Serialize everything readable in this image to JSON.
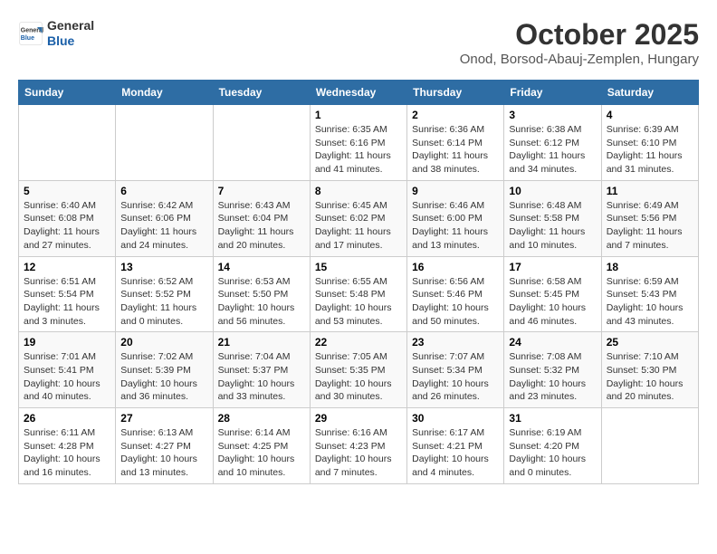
{
  "logo": {
    "line1": "General",
    "line2": "Blue"
  },
  "title": "October 2025",
  "location": "Onod, Borsod-Abauj-Zemplen, Hungary",
  "weekdays": [
    "Sunday",
    "Monday",
    "Tuesday",
    "Wednesday",
    "Thursday",
    "Friday",
    "Saturday"
  ],
  "weeks": [
    [
      {
        "day": "",
        "info": ""
      },
      {
        "day": "",
        "info": ""
      },
      {
        "day": "",
        "info": ""
      },
      {
        "day": "1",
        "info": "Sunrise: 6:35 AM\nSunset: 6:16 PM\nDaylight: 11 hours\nand 41 minutes."
      },
      {
        "day": "2",
        "info": "Sunrise: 6:36 AM\nSunset: 6:14 PM\nDaylight: 11 hours\nand 38 minutes."
      },
      {
        "day": "3",
        "info": "Sunrise: 6:38 AM\nSunset: 6:12 PM\nDaylight: 11 hours\nand 34 minutes."
      },
      {
        "day": "4",
        "info": "Sunrise: 6:39 AM\nSunset: 6:10 PM\nDaylight: 11 hours\nand 31 minutes."
      }
    ],
    [
      {
        "day": "5",
        "info": "Sunrise: 6:40 AM\nSunset: 6:08 PM\nDaylight: 11 hours\nand 27 minutes."
      },
      {
        "day": "6",
        "info": "Sunrise: 6:42 AM\nSunset: 6:06 PM\nDaylight: 11 hours\nand 24 minutes."
      },
      {
        "day": "7",
        "info": "Sunrise: 6:43 AM\nSunset: 6:04 PM\nDaylight: 11 hours\nand 20 minutes."
      },
      {
        "day": "8",
        "info": "Sunrise: 6:45 AM\nSunset: 6:02 PM\nDaylight: 11 hours\nand 17 minutes."
      },
      {
        "day": "9",
        "info": "Sunrise: 6:46 AM\nSunset: 6:00 PM\nDaylight: 11 hours\nand 13 minutes."
      },
      {
        "day": "10",
        "info": "Sunrise: 6:48 AM\nSunset: 5:58 PM\nDaylight: 11 hours\nand 10 minutes."
      },
      {
        "day": "11",
        "info": "Sunrise: 6:49 AM\nSunset: 5:56 PM\nDaylight: 11 hours\nand 7 minutes."
      }
    ],
    [
      {
        "day": "12",
        "info": "Sunrise: 6:51 AM\nSunset: 5:54 PM\nDaylight: 11 hours\nand 3 minutes."
      },
      {
        "day": "13",
        "info": "Sunrise: 6:52 AM\nSunset: 5:52 PM\nDaylight: 11 hours\nand 0 minutes."
      },
      {
        "day": "14",
        "info": "Sunrise: 6:53 AM\nSunset: 5:50 PM\nDaylight: 10 hours\nand 56 minutes."
      },
      {
        "day": "15",
        "info": "Sunrise: 6:55 AM\nSunset: 5:48 PM\nDaylight: 10 hours\nand 53 minutes."
      },
      {
        "day": "16",
        "info": "Sunrise: 6:56 AM\nSunset: 5:46 PM\nDaylight: 10 hours\nand 50 minutes."
      },
      {
        "day": "17",
        "info": "Sunrise: 6:58 AM\nSunset: 5:45 PM\nDaylight: 10 hours\nand 46 minutes."
      },
      {
        "day": "18",
        "info": "Sunrise: 6:59 AM\nSunset: 5:43 PM\nDaylight: 10 hours\nand 43 minutes."
      }
    ],
    [
      {
        "day": "19",
        "info": "Sunrise: 7:01 AM\nSunset: 5:41 PM\nDaylight: 10 hours\nand 40 minutes."
      },
      {
        "day": "20",
        "info": "Sunrise: 7:02 AM\nSunset: 5:39 PM\nDaylight: 10 hours\nand 36 minutes."
      },
      {
        "day": "21",
        "info": "Sunrise: 7:04 AM\nSunset: 5:37 PM\nDaylight: 10 hours\nand 33 minutes."
      },
      {
        "day": "22",
        "info": "Sunrise: 7:05 AM\nSunset: 5:35 PM\nDaylight: 10 hours\nand 30 minutes."
      },
      {
        "day": "23",
        "info": "Sunrise: 7:07 AM\nSunset: 5:34 PM\nDaylight: 10 hours\nand 26 minutes."
      },
      {
        "day": "24",
        "info": "Sunrise: 7:08 AM\nSunset: 5:32 PM\nDaylight: 10 hours\nand 23 minutes."
      },
      {
        "day": "25",
        "info": "Sunrise: 7:10 AM\nSunset: 5:30 PM\nDaylight: 10 hours\nand 20 minutes."
      }
    ],
    [
      {
        "day": "26",
        "info": "Sunrise: 6:11 AM\nSunset: 4:28 PM\nDaylight: 10 hours\nand 16 minutes."
      },
      {
        "day": "27",
        "info": "Sunrise: 6:13 AM\nSunset: 4:27 PM\nDaylight: 10 hours\nand 13 minutes."
      },
      {
        "day": "28",
        "info": "Sunrise: 6:14 AM\nSunset: 4:25 PM\nDaylight: 10 hours\nand 10 minutes."
      },
      {
        "day": "29",
        "info": "Sunrise: 6:16 AM\nSunset: 4:23 PM\nDaylight: 10 hours\nand 7 minutes."
      },
      {
        "day": "30",
        "info": "Sunrise: 6:17 AM\nSunset: 4:21 PM\nDaylight: 10 hours\nand 4 minutes."
      },
      {
        "day": "31",
        "info": "Sunrise: 6:19 AM\nSunset: 4:20 PM\nDaylight: 10 hours\nand 0 minutes."
      },
      {
        "day": "",
        "info": ""
      }
    ]
  ]
}
